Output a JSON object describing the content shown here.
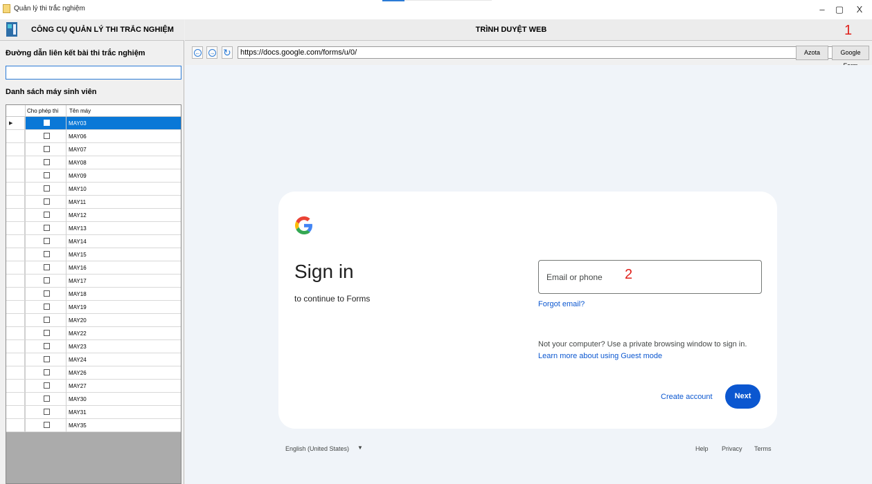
{
  "window": {
    "title": "Quản lý thi trắc nghiệm",
    "minimize": "–",
    "restore": "▢",
    "close": "X"
  },
  "left_panel": {
    "header_title": "CÔNG CỤ QUẢN LÝ THI TRẮC NGHIỆM",
    "link_label": "Đường dẫn liên kết bài thi trắc nghiệm",
    "link_value": "",
    "list_label": "Danh sách máy sinh viên",
    "grid": {
      "columns": [
        "Cho phép thi",
        "Tên máy"
      ],
      "selected_row": 0,
      "rows": [
        {
          "allowed": false,
          "name": "MAY03"
        },
        {
          "allowed": false,
          "name": "MAY06"
        },
        {
          "allowed": false,
          "name": "MAY07"
        },
        {
          "allowed": false,
          "name": "MAY08"
        },
        {
          "allowed": false,
          "name": "MAY09"
        },
        {
          "allowed": false,
          "name": "MAY10"
        },
        {
          "allowed": false,
          "name": "MAY11"
        },
        {
          "allowed": false,
          "name": "MAY12"
        },
        {
          "allowed": false,
          "name": "MAY13"
        },
        {
          "allowed": false,
          "name": "MAY14"
        },
        {
          "allowed": false,
          "name": "MAY15"
        },
        {
          "allowed": false,
          "name": "MAY16"
        },
        {
          "allowed": false,
          "name": "MAY17"
        },
        {
          "allowed": false,
          "name": "MAY18"
        },
        {
          "allowed": false,
          "name": "MAY19"
        },
        {
          "allowed": false,
          "name": "MAY20"
        },
        {
          "allowed": false,
          "name": "MAY22"
        },
        {
          "allowed": false,
          "name": "MAY23"
        },
        {
          "allowed": false,
          "name": "MAY24"
        },
        {
          "allowed": false,
          "name": "MAY26"
        },
        {
          "allowed": false,
          "name": "MAY27"
        },
        {
          "allowed": false,
          "name": "MAY30"
        },
        {
          "allowed": false,
          "name": "MAY31"
        },
        {
          "allowed": false,
          "name": "MAY35"
        }
      ]
    }
  },
  "browser": {
    "header_title": "TRÌNH DUYỆT WEB",
    "marker_1": "1",
    "url": "https://docs.google.com/forms/u/0/",
    "buttons": {
      "azota": "Azota",
      "google_form": "Google Form"
    },
    "icons": {
      "back": "←",
      "forward": "→",
      "refresh": "↻"
    }
  },
  "signin": {
    "title": "Sign in",
    "subtitle": "to continue to Forms",
    "email_placeholder": "Email or phone",
    "marker_2": "2",
    "forgot": "Forgot email?",
    "note": "Not your computer? Use a private browsing window to sign in.",
    "note_link": "Learn more about using Guest mode",
    "create_account": "Create account",
    "next": "Next",
    "footer": {
      "language": "English (United States)",
      "caret": "▼",
      "help": "Help",
      "privacy": "Privacy",
      "terms": "Terms"
    }
  },
  "colors": {
    "selection": "#0a78d7",
    "google_blue": "#0b57d0",
    "marker_red": "#e0201a",
    "webview_bg": "#f0f4f9"
  }
}
